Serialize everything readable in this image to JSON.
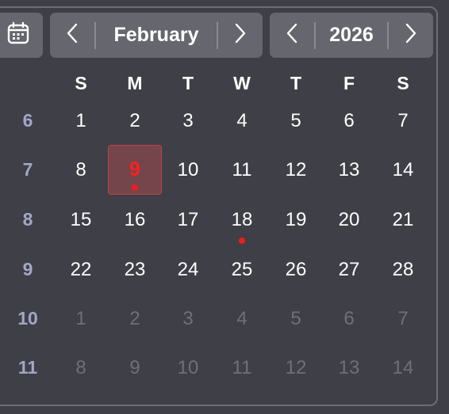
{
  "header": {
    "month": "February",
    "year": "2026",
    "calendar_icon": "calendar-icon",
    "prev_icon": "chevron-left-icon",
    "next_icon": "chevron-right-icon"
  },
  "weekdays": [
    "S",
    "M",
    "T",
    "W",
    "T",
    "F",
    "S"
  ],
  "weeks": [
    {
      "number": "6",
      "days": [
        "1",
        "2",
        "3",
        "4",
        "5",
        "6",
        "7"
      ]
    },
    {
      "number": "7",
      "days": [
        "8",
        "9",
        "10",
        "11",
        "12",
        "13",
        "14"
      ]
    },
    {
      "number": "8",
      "days": [
        "15",
        "16",
        "17",
        "18",
        "19",
        "20",
        "21"
      ]
    },
    {
      "number": "9",
      "days": [
        "22",
        "23",
        "24",
        "25",
        "26",
        "27",
        "28"
      ]
    },
    {
      "number": "10",
      "days": [
        "1",
        "2",
        "3",
        "4",
        "5",
        "6",
        "7"
      ]
    },
    {
      "number": "11",
      "days": [
        "8",
        "9",
        "10",
        "11",
        "12",
        "13",
        "14"
      ]
    }
  ],
  "other_month_weeks": [
    4,
    5
  ],
  "today": {
    "week": 1,
    "day": 1
  },
  "event_days": [
    {
      "week": 1,
      "day": 1
    },
    {
      "week": 2,
      "day": 3
    }
  ],
  "colors": {
    "background": "#3f3f47",
    "button": "#66666f",
    "week_number": "#a3a6c6",
    "other_month_day": "#6f6f78",
    "today_fill": "#74464c",
    "today_text": "#ff2020",
    "event_dot": "#ee1e1e"
  }
}
